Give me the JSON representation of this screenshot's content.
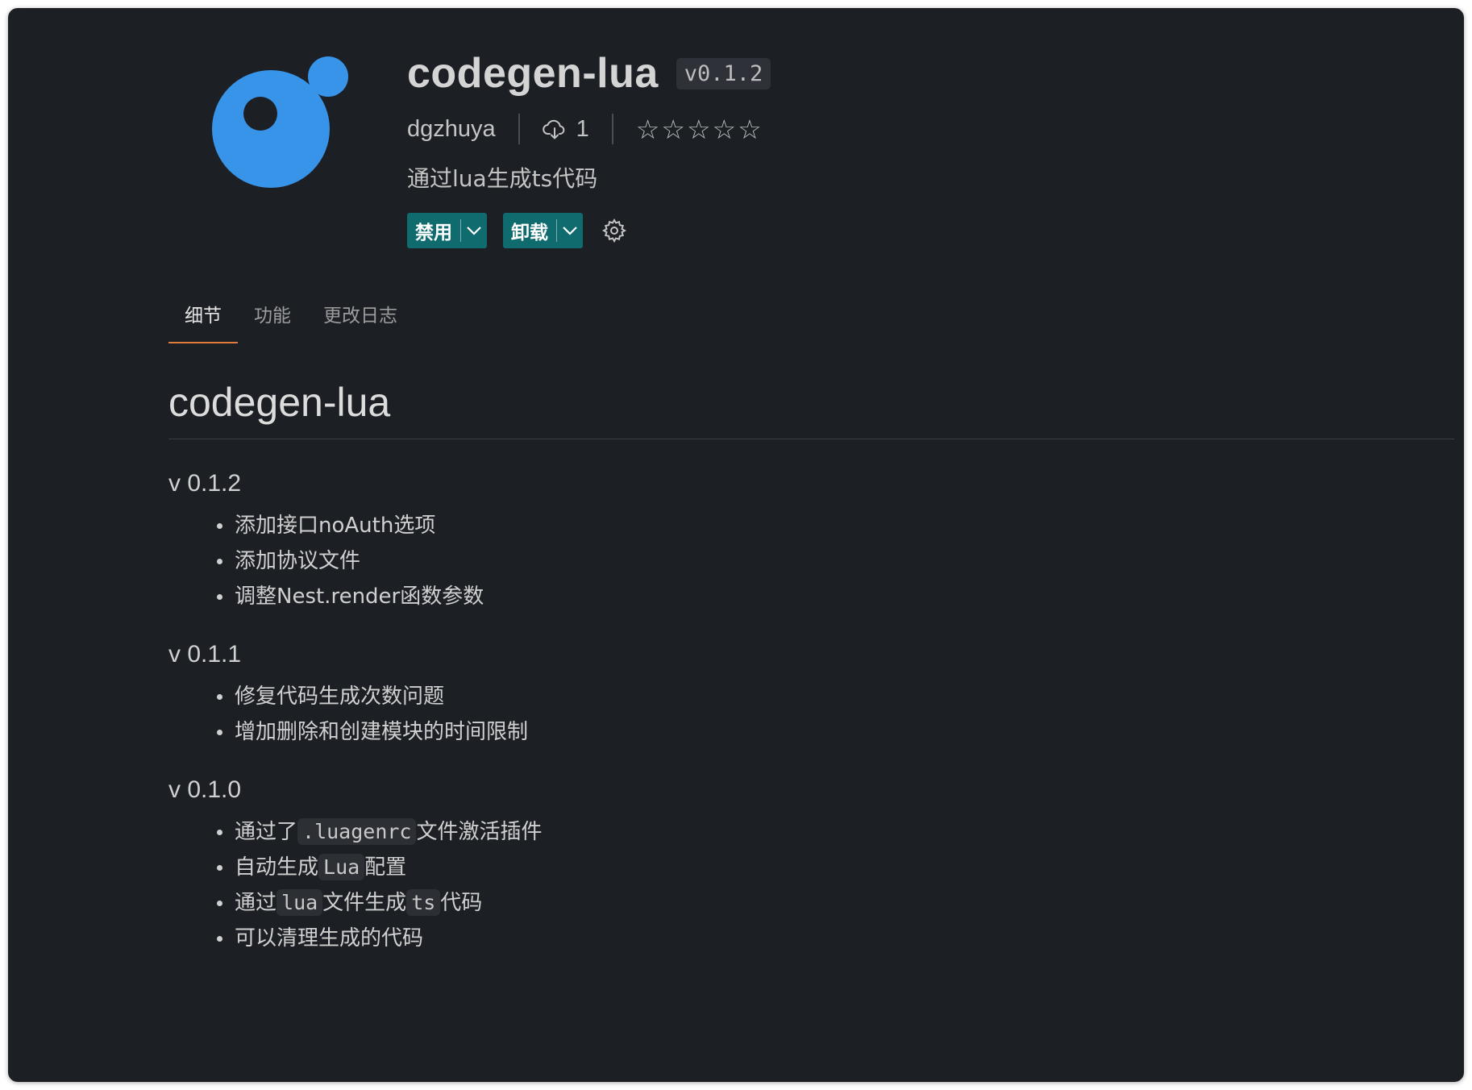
{
  "extension": {
    "name": "codegen-lua",
    "version": "v0.1.2",
    "publisher": "dgzhuya",
    "install_count": "1",
    "rating_stars": "☆☆☆☆☆",
    "description": "通过lua生成ts代码",
    "logo_icon": "blue-bubble-logo",
    "logo_color": "#3794e8"
  },
  "actions": {
    "disable_label": "禁用",
    "uninstall_label": "卸载",
    "button_color": "#106b6e",
    "caret_icon": "chevron-down-icon",
    "settings_icon": "gear-icon"
  },
  "tabs": [
    {
      "label": "细节",
      "active": true
    },
    {
      "label": "功能",
      "active": false
    },
    {
      "label": "更改日志",
      "active": false
    }
  ],
  "readme": {
    "title": "codegen-lua",
    "releases": [
      {
        "version": "v 0.1.2",
        "items": [
          {
            "parts": [
              {
                "t": "添加接口noAuth选项"
              }
            ]
          },
          {
            "parts": [
              {
                "t": "添加协议文件"
              }
            ]
          },
          {
            "parts": [
              {
                "t": "调整Nest.render函数参数"
              }
            ]
          }
        ]
      },
      {
        "version": "v 0.1.1",
        "items": [
          {
            "parts": [
              {
                "t": "修复代码生成次数问题"
              }
            ]
          },
          {
            "parts": [
              {
                "t": "增加删除和创建模块的时间限制"
              }
            ]
          }
        ]
      },
      {
        "version": "v 0.1.0",
        "items": [
          {
            "parts": [
              {
                "t": "通过了"
              },
              {
                "code": ".luagenrc"
              },
              {
                "t": "文件激活插件"
              }
            ]
          },
          {
            "parts": [
              {
                "t": "自动生成"
              },
              {
                "code": "Lua"
              },
              {
                "t": "配置"
              }
            ]
          },
          {
            "parts": [
              {
                "t": "通过"
              },
              {
                "code": "lua"
              },
              {
                "t": "文件生成"
              },
              {
                "code": "ts"
              },
              {
                "t": "代码"
              }
            ]
          },
          {
            "parts": [
              {
                "t": "可以清理生成的代码"
              }
            ]
          }
        ]
      }
    ]
  },
  "colors": {
    "background": "#1c1f24",
    "active_tab_underline": "#e07b3c"
  }
}
